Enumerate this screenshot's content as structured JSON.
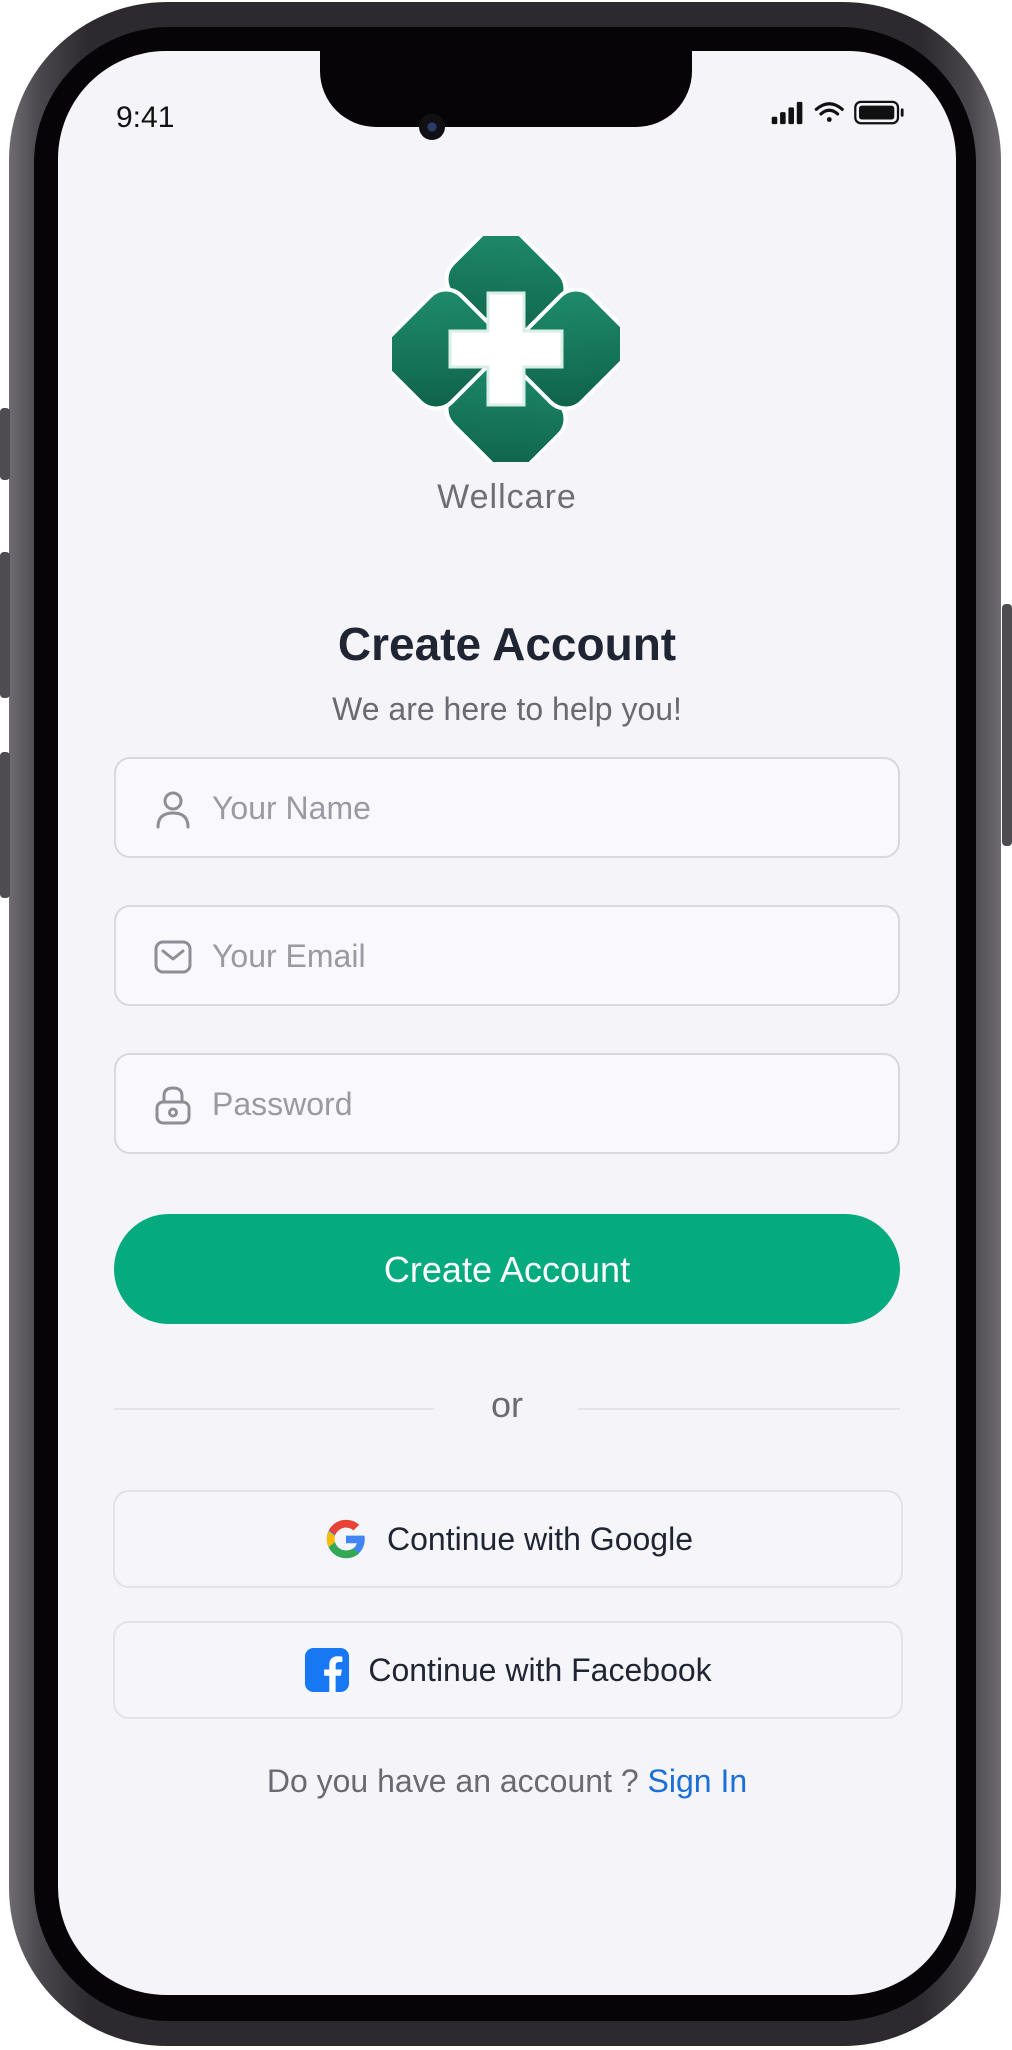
{
  "status_bar": {
    "time": "9:41"
  },
  "brand": {
    "name": "Wellcare"
  },
  "header": {
    "title": "Create Account",
    "subtitle": "We are here to help you!"
  },
  "form": {
    "name_placeholder": "Your Name",
    "email_placeholder": "Your Email",
    "password_placeholder": "Password",
    "submit_label": "Create Account"
  },
  "divider": {
    "label": "or"
  },
  "social": {
    "google_label": "Continue with Google",
    "facebook_label": "Continue with Facebook"
  },
  "footer": {
    "prompt": "Do you have an account ?",
    "link_label": "Sign In"
  },
  "icons": {
    "name_field": "person-icon",
    "email_field": "mail-icon",
    "password_field": "lock-icon",
    "google": "google-icon",
    "facebook": "facebook-icon"
  },
  "colors": {
    "accent": "#05aa7f",
    "logo_green": "#147a5e",
    "link": "#1a6fd8",
    "background": "#f5f4f8",
    "title": "#1f2533"
  }
}
